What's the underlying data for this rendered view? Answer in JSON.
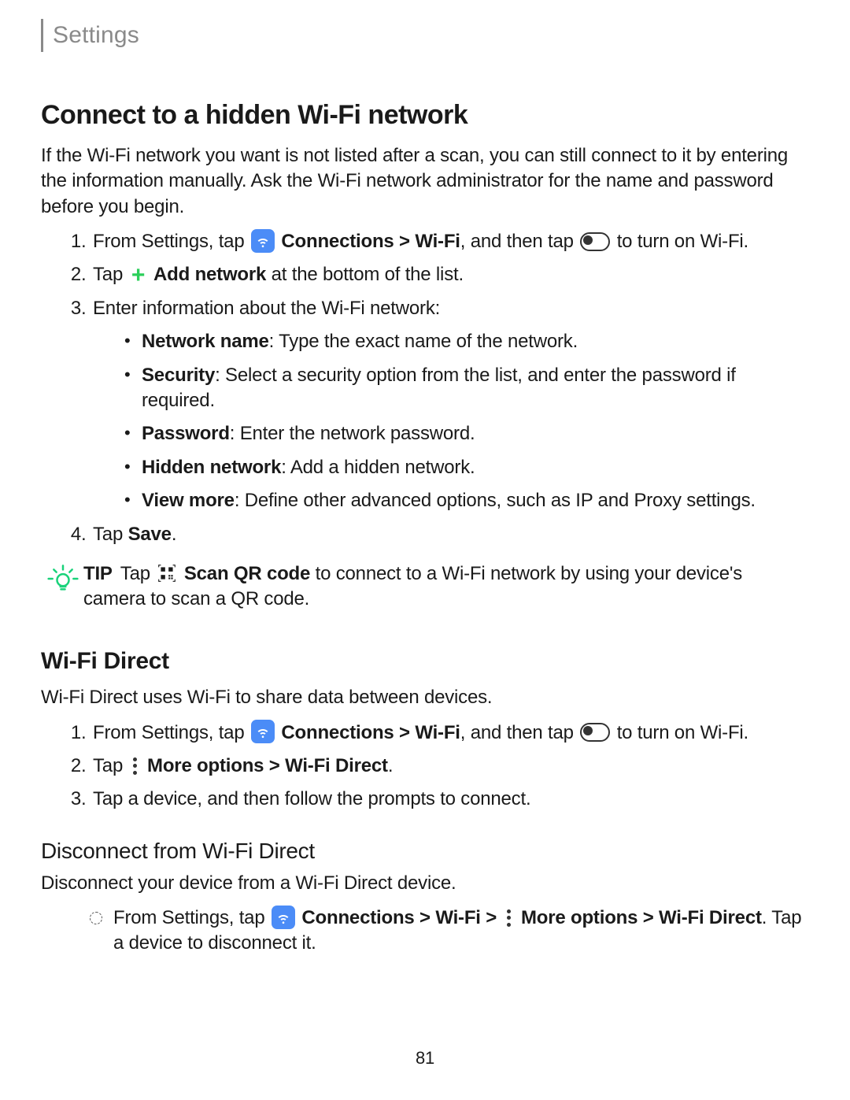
{
  "breadcrumb": "Settings",
  "page_number": "81",
  "section1": {
    "heading": "Connect to a hidden Wi-Fi network",
    "intro": "If the Wi-Fi network you want is not listed after a scan, you can still connect to it by entering the information manually. Ask the Wi-Fi network administrator for the name and password before you begin.",
    "step1_a": "From Settings, tap",
    "step1_conn": "Connections",
    "step1_gt": " > ",
    "step1_wifi": "Wi-Fi",
    "step1_b": ", and then tap",
    "step1_c": "to turn on Wi-Fi.",
    "step2_a": "Tap",
    "step2_add": "Add network",
    "step2_b": " at the bottom of the list.",
    "step3": "Enter information about the Wi-Fi network:",
    "bullets": {
      "b1_label": "Network name",
      "b1_text": ": Type the exact name of the network.",
      "b2_label": "Security",
      "b2_text": ": Select a security option from the list, and enter the password if required.",
      "b3_label": "Password",
      "b3_text": ": Enter the network password.",
      "b4_label": "Hidden network",
      "b4_text": ": Add a hidden network.",
      "b5_label": "View more",
      "b5_text": ": Define other advanced options, such as IP and Proxy settings."
    },
    "step4_a": "Tap ",
    "step4_save": "Save",
    "step4_b": ".",
    "tip": {
      "label": "TIP",
      "a": "Tap",
      "scan": "Scan QR code",
      "b": " to connect to a Wi-Fi network by using your device's camera to scan a QR code."
    }
  },
  "section2": {
    "heading": "Wi-Fi Direct",
    "intro": "Wi-Fi Direct uses Wi-Fi to share data between devices.",
    "step1_a": "From Settings, tap",
    "step1_conn": "Connections",
    "step1_gt": " > ",
    "step1_wifi": "Wi-Fi",
    "step1_b": ", and then tap",
    "step1_c": "to turn on Wi-Fi.",
    "step2_a": "Tap",
    "step2_more": "More options",
    "step2_gt": " > ",
    "step2_wfd": "Wi-Fi Direct",
    "step2_b": ".",
    "step3": "Tap a device, and then follow the prompts to connect."
  },
  "section3": {
    "heading": "Disconnect from Wi-Fi Direct",
    "intro": "Disconnect your device from a Wi-Fi Direct device.",
    "item_a": "From Settings, tap",
    "item_conn": "Connections",
    "item_gt1": " > ",
    "item_wifi": "Wi-Fi",
    "item_gt2": " > ",
    "item_more": "More options",
    "item_gt3": " > ",
    "item_wfd": "Wi-Fi Direct",
    "item_b": ". Tap a device to disconnect it."
  }
}
